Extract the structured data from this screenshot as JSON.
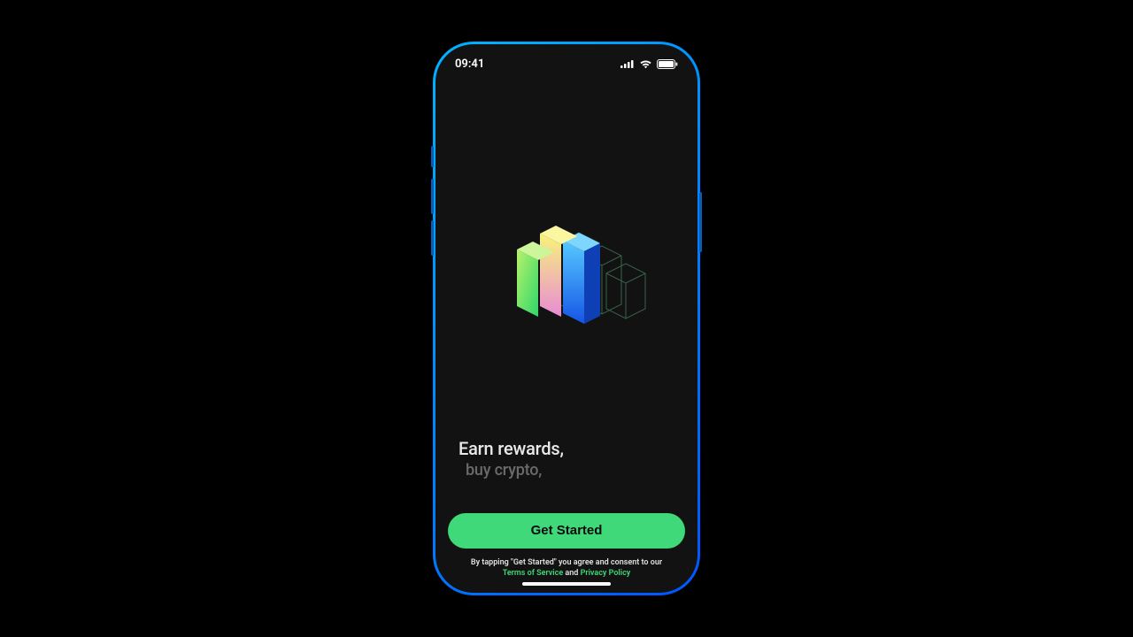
{
  "status": {
    "time": "09:41"
  },
  "tagline": {
    "line1": "Earn rewards,",
    "line2": "buy crypto,"
  },
  "cta": {
    "label": "Get Started"
  },
  "legal": {
    "prefix": "By tapping \"Get Started\" you agree and consent to our",
    "tos": "Terms of Service",
    "and": " and ",
    "privacy": "Privacy Policy"
  }
}
